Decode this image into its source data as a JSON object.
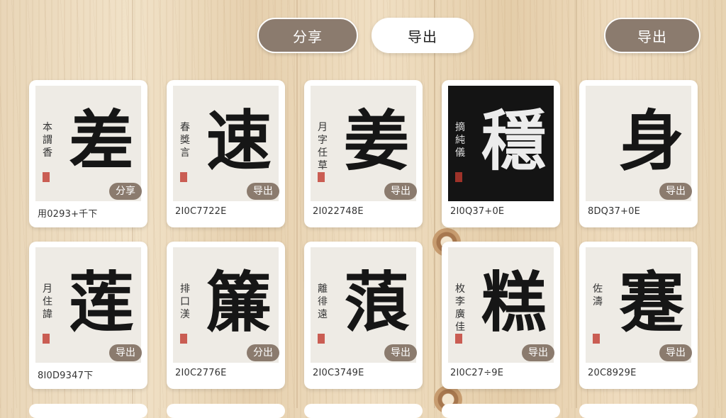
{
  "topbar": {
    "share_label": "分享",
    "export_label": "导出",
    "export_right_label": "导出"
  },
  "cards": [
    {
      "glyph": "差",
      "side": "本謂香",
      "badge": "分享",
      "code": "用0293+千下",
      "dark": false
    },
    {
      "glyph": "速",
      "side": "春獎言",
      "badge": "导出",
      "code": "2I0C7722E",
      "dark": false
    },
    {
      "glyph": "姜",
      "side": "月字任草",
      "badge": "导出",
      "code": "2I022748E",
      "dark": false
    },
    {
      "glyph": "穩",
      "side": "摘純儀",
      "badge": "",
      "code": "2I0Q37+0E",
      "dark": true
    },
    {
      "glyph": "身",
      "side": "",
      "badge": "导出",
      "code": "8DQ37+0E",
      "dark": false
    },
    {
      "glyph": "莲",
      "side": "月住諱",
      "badge": "导出",
      "code": "8I0D9347下",
      "dark": false
    },
    {
      "glyph": "簾",
      "side": "排口渼",
      "badge": "分出",
      "code": "2I0C2776E",
      "dark": false
    },
    {
      "glyph": "蒗",
      "side": "離徘遠",
      "badge": "导出",
      "code": "2I0C3749E",
      "dark": false
    },
    {
      "glyph": "糕",
      "side": "枚李廣佳",
      "badge": "导出",
      "code": "2I0C27÷9E",
      "dark": false
    },
    {
      "glyph": "蹇",
      "side": "佐濤",
      "badge": "导出",
      "code": "20C8929E",
      "dark": false
    }
  ]
}
